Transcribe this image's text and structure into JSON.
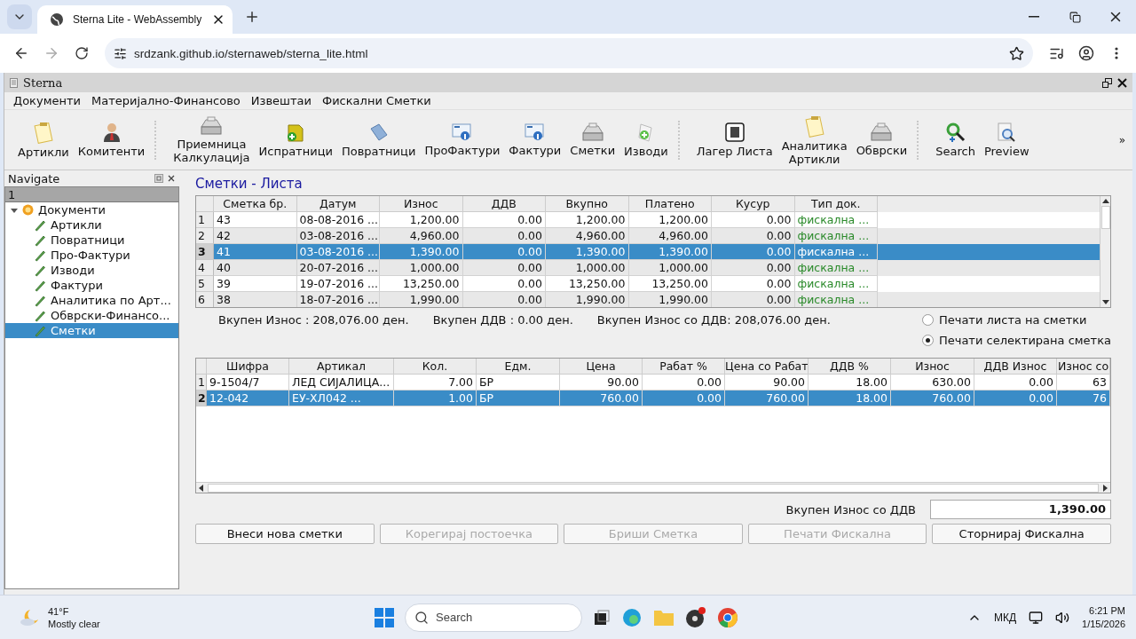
{
  "browser": {
    "tab_title": "Sterna Lite - WebAssembly",
    "url": "srdzank.github.io/sternaweb/sterna_lite.html"
  },
  "app": {
    "title": "Sterna",
    "menu": [
      "Документи",
      "Материјално-Финансово",
      "Извештаи",
      "Фискални Сметки"
    ],
    "toolbar_groups": [
      [
        "Артикли",
        "Комитенти"
      ],
      [
        "Приемница\nКалкулација",
        "Испратници",
        "Повратници",
        "ПроФактури",
        "Фактури",
        "Сметки",
        "Изводи"
      ],
      [
        "Лагер Листа",
        "Аналитика\nАртикли",
        "Обврски"
      ],
      [
        "Search",
        "Preview"
      ]
    ],
    "toolbar_more": "»"
  },
  "navigate": {
    "title": "Navigate",
    "header": "1",
    "tree": [
      {
        "label": "Документи",
        "expanded": true,
        "selected": false,
        "children": [
          {
            "label": "Артикли",
            "selected": false
          },
          {
            "label": "Повратници",
            "selected": false
          },
          {
            "label": "Про-Фактури",
            "selected": false
          },
          {
            "label": "Изводи",
            "selected": false
          },
          {
            "label": "Фактури",
            "selected": false
          },
          {
            "label": "Аналитика по Арт...",
            "selected": false
          },
          {
            "label": "Обврски-Финансо...",
            "selected": false
          },
          {
            "label": "Сметки",
            "selected": true
          }
        ]
      }
    ]
  },
  "main": {
    "heading": "Сметки - Листа",
    "bills": {
      "columns": [
        "Сметка бр.",
        "Датум",
        "Износ",
        "ДДВ",
        "Вкупно",
        "Платено",
        "Кусур",
        "Тип док."
      ],
      "rows": [
        {
          "number": "1",
          "cells": [
            "43",
            "08-08-2016 ...",
            "1,200.00",
            "0.00",
            "1,200.00",
            "1,200.00",
            "0.00",
            "фискална ..."
          ],
          "selected": false
        },
        {
          "number": "2",
          "cells": [
            "42",
            "03-08-2016 ...",
            "4,960.00",
            "0.00",
            "4,960.00",
            "4,960.00",
            "0.00",
            "фискална ..."
          ],
          "selected": false
        },
        {
          "number": "3",
          "cells": [
            "41",
            "03-08-2016 ...",
            "1,390.00",
            "0.00",
            "1,390.00",
            "1,390.00",
            "0.00",
            "фискална ..."
          ],
          "selected": true
        },
        {
          "number": "4",
          "cells": [
            "40",
            "20-07-2016 ...",
            "1,000.00",
            "0.00",
            "1,000.00",
            "1,000.00",
            "0.00",
            "фискална ..."
          ],
          "selected": false
        },
        {
          "number": "5",
          "cells": [
            "39",
            "19-07-2016 ...",
            "13,250.00",
            "0.00",
            "13,250.00",
            "13,250.00",
            "0.00",
            "фискална ..."
          ],
          "selected": false
        },
        {
          "number": "6",
          "cells": [
            "38",
            "18-07-2016 ...",
            "1,990.00",
            "0.00",
            "1,990.00",
            "1,990.00",
            "0.00",
            "фискална ..."
          ],
          "selected": false
        }
      ]
    },
    "totals": [
      "Вкупен Износ : 208,076.00 ден.",
      "Вкупен ДДВ : 0.00 ден.",
      "Вкупен Износ со ДДВ: 208,076.00 ден."
    ],
    "print_options": [
      {
        "label": "Печати листа на сметки",
        "selected": false
      },
      {
        "label": "Печати селектирана сметка",
        "selected": true
      }
    ],
    "items": {
      "columns": [
        "Шифра",
        "Артикал",
        "Кол.",
        "Едм.",
        "Цена",
        "Рабат %",
        "Цена со Рабат",
        "ДДВ %",
        "Износ",
        "ДДВ Износ",
        "Износ со"
      ],
      "rows": [
        {
          "number": "1",
          "cells": [
            "9-1504/7",
            "ЛЕД СИЈАЛИЦА...",
            "7.00",
            "БР",
            "90.00",
            "0.00",
            "90.00",
            "18.00",
            "630.00",
            "0.00",
            "63"
          ],
          "selected": false
        },
        {
          "number": "2",
          "cells": [
            "12-042",
            "ЕУ-ХЛ042 ...",
            "1.00",
            "БР",
            "760.00",
            "0.00",
            "760.00",
            "18.00",
            "760.00",
            "0.00",
            "76"
          ],
          "selected": true
        }
      ]
    },
    "total_label": "Вкупен Износ со ДДВ",
    "total_value": "1,390.00",
    "buttons": [
      {
        "label": "Внеси нова сметки",
        "disabled": false
      },
      {
        "label": "Корегирај постоечка",
        "disabled": true
      },
      {
        "label": "Бриши Сметка",
        "disabled": true
      },
      {
        "label": "Печати Фискална",
        "disabled": true
      },
      {
        "label": "Сторнирај Фискална",
        "disabled": false
      }
    ]
  },
  "taskbar": {
    "temperature": "41°F",
    "weather": "Mostly clear",
    "search_placeholder": "Search",
    "language": "МКД",
    "time": "6:21 PM",
    "date": "1/15/2026"
  }
}
